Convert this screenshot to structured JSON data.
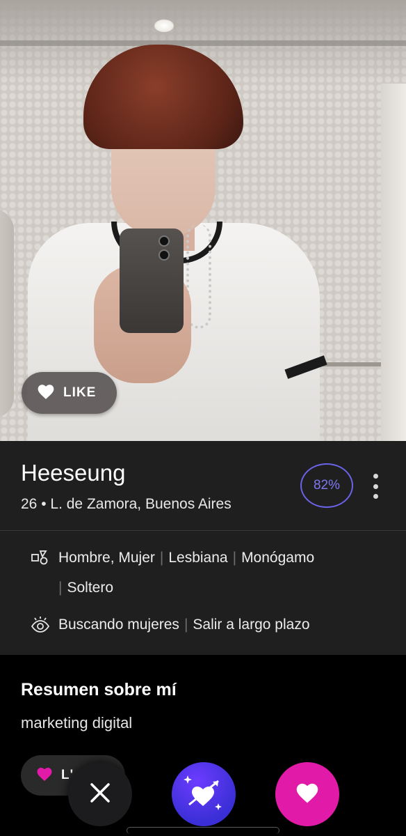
{
  "photo_like": {
    "label": "LIKE",
    "icon": "heart-icon"
  },
  "profile": {
    "name": "Heeseung",
    "age": "26",
    "separator": "•",
    "location": "L. de Zamora, Buenos Aires",
    "match_percent": "82%"
  },
  "details": {
    "identity": [
      "Hombre, Mujer",
      "Lesbiana",
      "Monógamo",
      "Soltero"
    ],
    "looking_for": [
      "Buscando mujeres",
      "Salir a largo plazo"
    ]
  },
  "summary": {
    "title": "Resumen sobre mí",
    "text": "marketing digital"
  },
  "bottom_like": {
    "label": "L'"
  },
  "colors": {
    "accent_purple": "#6a63e8",
    "like_pink": "#e21aa8",
    "superlike_blue": "#3a2fd6",
    "panel": "#1f1f1f"
  }
}
